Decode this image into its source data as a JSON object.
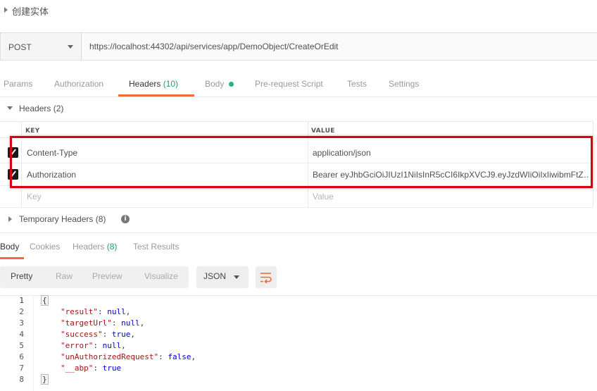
{
  "request": {
    "title": "创建实体",
    "method": "POST",
    "url": "https://localhost:44302/api/services/app/DemoObject/CreateOrEdit"
  },
  "tabs": [
    {
      "label": "Params"
    },
    {
      "label": "Authorization"
    },
    {
      "label": "Headers",
      "count": "(10)"
    },
    {
      "label": "Body"
    },
    {
      "label": "Pre-request Script"
    },
    {
      "label": "Tests"
    },
    {
      "label": "Settings"
    }
  ],
  "headers_section": {
    "title": "Headers (2)",
    "col_key": "KEY",
    "col_value": "VALUE",
    "rows": [
      {
        "key": "Content-Type",
        "value": "application/json",
        "checked": true
      },
      {
        "key": "Authorization",
        "value": "Bearer eyJhbGciOiJIUzI1NiIsInR5cCI6IkpXVCJ9.eyJzdWIiOiIxIiwibmFtZ…",
        "checked": true
      }
    ],
    "key_placeholder": "Key",
    "value_placeholder": "Value",
    "temporary_title": "Temporary Headers (8)",
    "info_glyph": "i"
  },
  "response_tabs": [
    {
      "label": "Body"
    },
    {
      "label": "Cookies"
    },
    {
      "label": "Headers",
      "count": "(8)"
    },
    {
      "label": "Test Results"
    }
  ],
  "format": {
    "buttons": [
      "Pretty",
      "Raw",
      "Preview",
      "Visualize"
    ],
    "selected_type": "JSON"
  },
  "code": {
    "line_numbers": [
      "1",
      "2",
      "3",
      "4",
      "5",
      "6",
      "7",
      "8"
    ],
    "open_brace": "{",
    "close_brace": "}",
    "entries": [
      {
        "key": "\"result\"",
        "value": "null"
      },
      {
        "key": "\"targetUrl\"",
        "value": "null"
      },
      {
        "key": "\"success\"",
        "value": "true"
      },
      {
        "key": "\"error\"",
        "value": "null"
      },
      {
        "key": "\"unAuthorizedRequest\"",
        "value": "false"
      },
      {
        "key": "\"__abp\"",
        "value": "true"
      }
    ]
  },
  "colors": {
    "accent_orange": "#f26b3a",
    "count_green": "#20a060",
    "highlight_red": "#d9000f",
    "json_key": "#a31515",
    "json_value": "#0000cc"
  }
}
